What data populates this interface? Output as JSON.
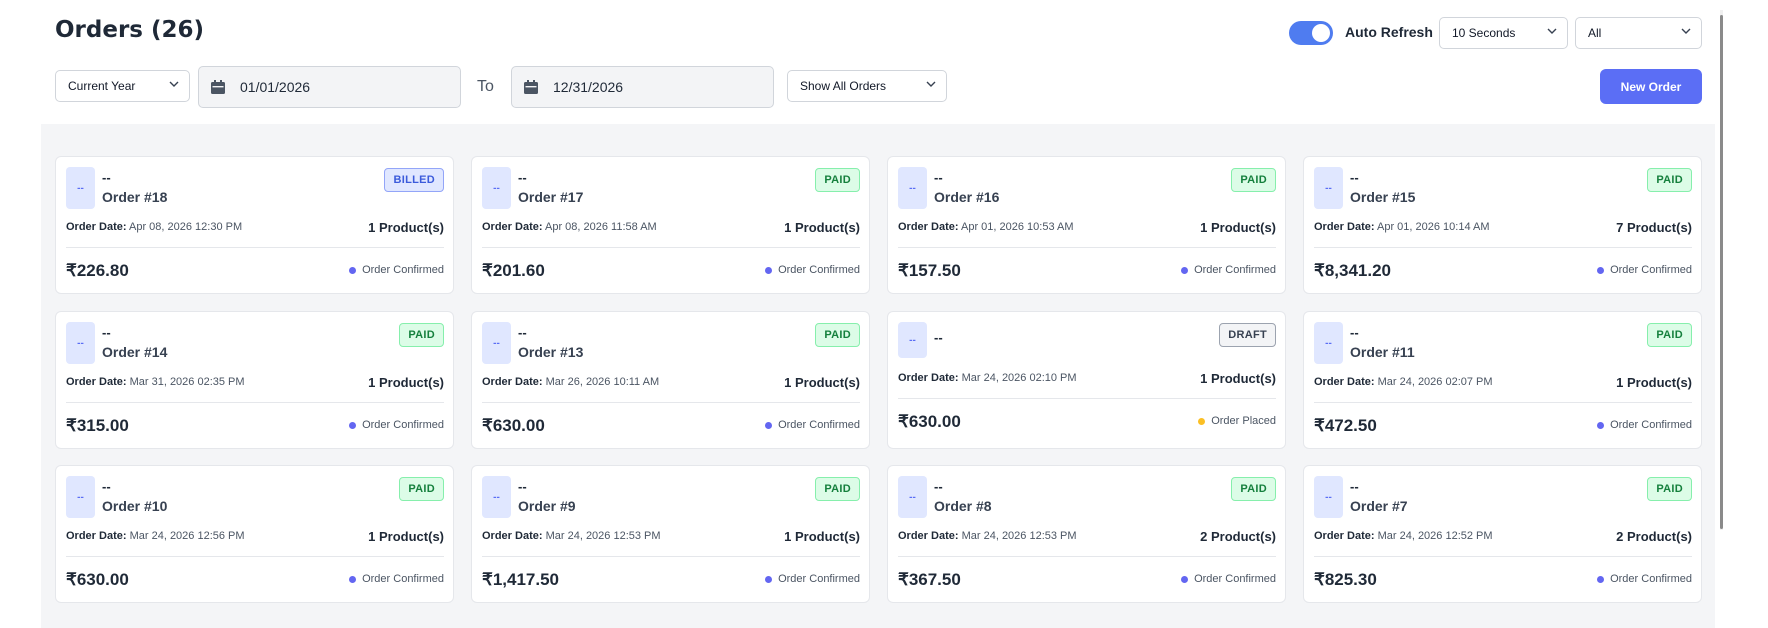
{
  "page": {
    "title": "Orders (26)"
  },
  "auto_refresh": {
    "label": "Auto Refresh",
    "enabled": true,
    "interval": "10 Seconds"
  },
  "filter_all": "All",
  "period_select": "Current Year",
  "date_from": "01/01/2026",
  "to_label": "To",
  "date_to": "12/31/2026",
  "order_filter": "Show All Orders",
  "new_order_label": "New Order",
  "colors": {
    "accent": "#5b6ef5",
    "confirmed": "#6366f1",
    "placed": "#fbbf24"
  },
  "orders": [
    {
      "avatar": "--",
      "customer": "--",
      "name": "Order #18",
      "badge": "BILLED",
      "badge_type": "billed",
      "date_label": "Order Date:",
      "date": "Apr 08, 2026 12:30 PM",
      "products": "1 Product(s)",
      "amount": "₹226.80",
      "status": "Order Confirmed",
      "status_color": "#6366f1"
    },
    {
      "avatar": "--",
      "customer": "--",
      "name": "Order #17",
      "badge": "PAID",
      "badge_type": "paid",
      "date_label": "Order Date:",
      "date": "Apr 08, 2026 11:58 AM",
      "products": "1 Product(s)",
      "amount": "₹201.60",
      "status": "Order Confirmed",
      "status_color": "#6366f1"
    },
    {
      "avatar": "--",
      "customer": "--",
      "name": "Order #16",
      "badge": "PAID",
      "badge_type": "paid",
      "date_label": "Order Date:",
      "date": "Apr 01, 2026 10:53 AM",
      "products": "1 Product(s)",
      "amount": "₹157.50",
      "status": "Order Confirmed",
      "status_color": "#6366f1"
    },
    {
      "avatar": "--",
      "customer": "--",
      "name": "Order #15",
      "badge": "PAID",
      "badge_type": "paid",
      "date_label": "Order Date:",
      "date": "Apr 01, 2026 10:14 AM",
      "products": "7 Product(s)",
      "amount": "₹8,341.20",
      "status": "Order Confirmed",
      "status_color": "#6366f1"
    },
    {
      "avatar": "--",
      "customer": "--",
      "name": "Order #14",
      "badge": "PAID",
      "badge_type": "paid",
      "date_label": "Order Date:",
      "date": "Mar 31, 2026 02:35 PM",
      "products": "1 Product(s)",
      "amount": "₹315.00",
      "status": "Order Confirmed",
      "status_color": "#6366f1"
    },
    {
      "avatar": "--",
      "customer": "--",
      "name": "Order #13",
      "badge": "PAID",
      "badge_type": "paid",
      "date_label": "Order Date:",
      "date": "Mar 26, 2026 10:11 AM",
      "products": "1 Product(s)",
      "amount": "₹630.00",
      "status": "Order Confirmed",
      "status_color": "#6366f1"
    },
    {
      "avatar": "--",
      "customer": "--",
      "name": "",
      "badge": "DRAFT",
      "badge_type": "draft",
      "date_label": "Order Date:",
      "date": "Mar 24, 2026 02:10 PM",
      "products": "1 Product(s)",
      "amount": "₹630.00",
      "status": "Order Placed",
      "status_color": "#fbbf24"
    },
    {
      "avatar": "--",
      "customer": "--",
      "name": "Order #11",
      "badge": "PAID",
      "badge_type": "paid",
      "date_label": "Order Date:",
      "date": "Mar 24, 2026 02:07 PM",
      "products": "1 Product(s)",
      "amount": "₹472.50",
      "status": "Order Confirmed",
      "status_color": "#6366f1"
    },
    {
      "avatar": "--",
      "customer": "--",
      "name": "Order #10",
      "badge": "PAID",
      "badge_type": "paid",
      "date_label": "Order Date:",
      "date": "Mar 24, 2026 12:56 PM",
      "products": "1 Product(s)",
      "amount": "₹630.00",
      "status": "Order Confirmed",
      "status_color": "#6366f1"
    },
    {
      "avatar": "--",
      "customer": "--",
      "name": "Order #9",
      "badge": "PAID",
      "badge_type": "paid",
      "date_label": "Order Date:",
      "date": "Mar 24, 2026 12:53 PM",
      "products": "1 Product(s)",
      "amount": "₹1,417.50",
      "status": "Order Confirmed",
      "status_color": "#6366f1"
    },
    {
      "avatar": "--",
      "customer": "--",
      "name": "Order #8",
      "badge": "PAID",
      "badge_type": "paid",
      "date_label": "Order Date:",
      "date": "Mar 24, 2026 12:53 PM",
      "products": "2 Product(s)",
      "amount": "₹367.50",
      "status": "Order Confirmed",
      "status_color": "#6366f1"
    },
    {
      "avatar": "--",
      "customer": "--",
      "name": "Order #7",
      "badge": "PAID",
      "badge_type": "paid",
      "date_label": "Order Date:",
      "date": "Mar 24, 2026 12:52 PM",
      "products": "2 Product(s)",
      "amount": "₹825.30",
      "status": "Order Confirmed",
      "status_color": "#6366f1"
    }
  ]
}
